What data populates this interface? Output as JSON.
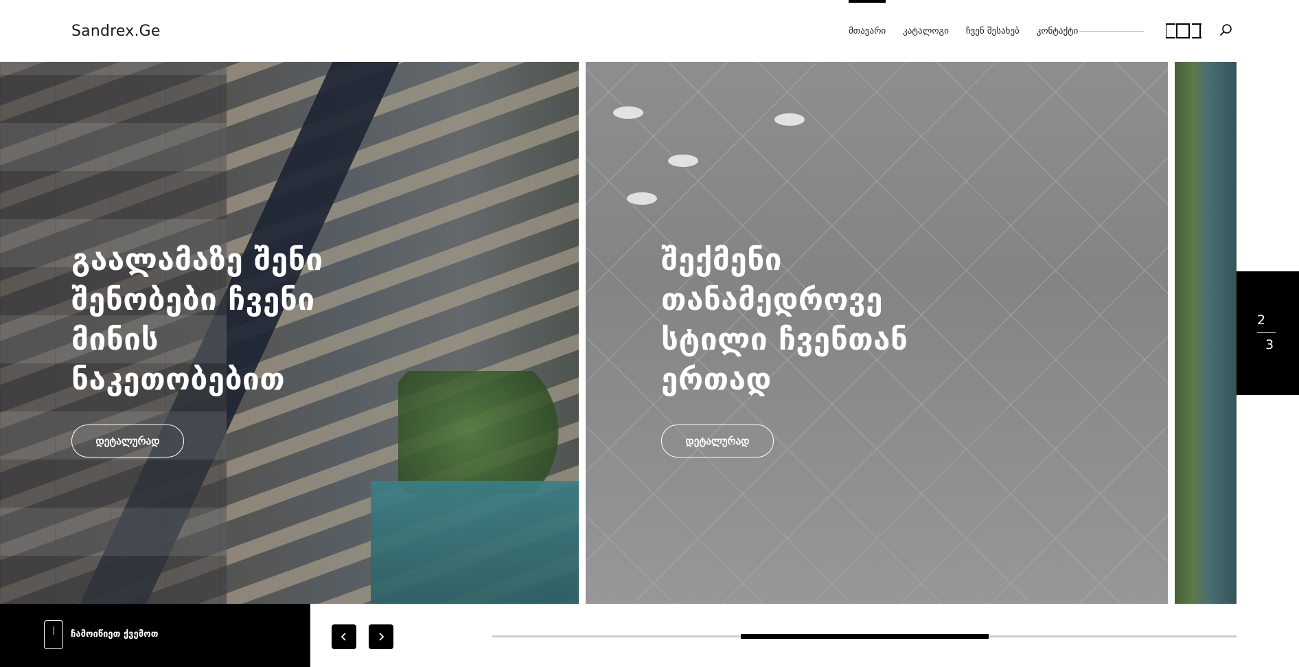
{
  "header": {
    "logo": "Sandrex.Ge",
    "nav": [
      {
        "label": "მთავარი",
        "active": true
      },
      {
        "label": "კატალოგი",
        "active": false
      },
      {
        "label": "ჩვენ შესახებ",
        "active": false
      },
      {
        "label": "კონტაქტი",
        "active": false
      }
    ],
    "icons": {
      "layout": "layout-brackets-icon",
      "search": "search-icon"
    }
  },
  "slides": [
    {
      "heading": "გაალამაზე შენი შენობები ჩვენი მინის ნაკეთობებით",
      "button_label": "დეტალურად"
    },
    {
      "heading": "შექმენი თანამედროვე სტილი ჩვენთან ერთად",
      "button_label": "დეტალურად"
    }
  ],
  "counter": {
    "current": "2",
    "total": "3"
  },
  "bottom": {
    "scroll_label": "ჩამოიწიეთ ქვემოთ",
    "prev_icon": "chevron-left-icon",
    "next_icon": "chevron-right-icon"
  },
  "colors": {
    "accent": "#000000",
    "text_on_image": "#ffffff",
    "track": "#cccccc"
  }
}
